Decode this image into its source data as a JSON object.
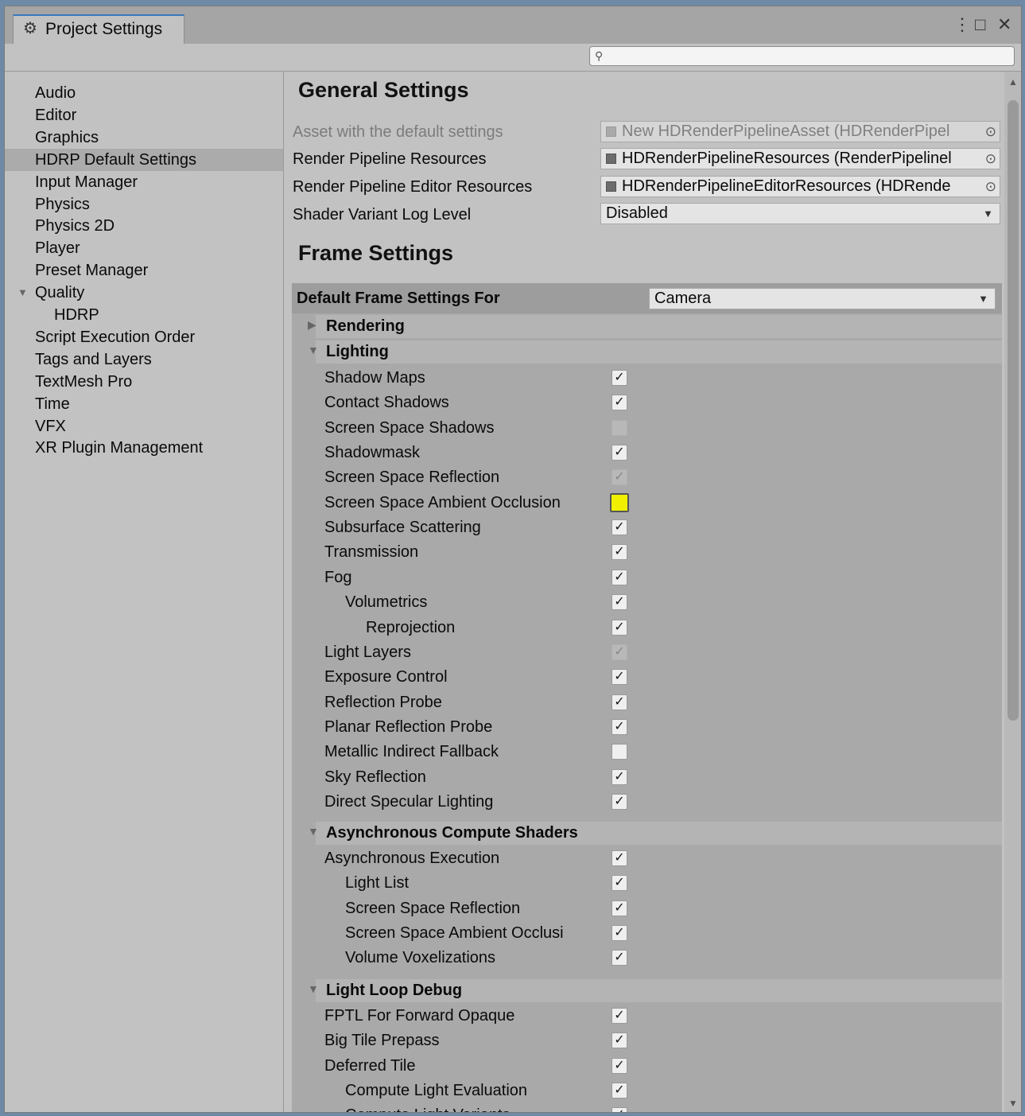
{
  "window": {
    "tab_title": "Project Settings",
    "controls": {
      "menu": "⋮",
      "maximize": "□",
      "close": "✕"
    }
  },
  "search": {
    "placeholder": "",
    "value": ""
  },
  "sidebar": {
    "items": [
      {
        "label": "Audio"
      },
      {
        "label": "Editor"
      },
      {
        "label": "Graphics"
      },
      {
        "label": "HDRP Default Settings",
        "selected": true
      },
      {
        "label": "Input Manager"
      },
      {
        "label": "Physics"
      },
      {
        "label": "Physics 2D"
      },
      {
        "label": "Player"
      },
      {
        "label": "Preset Manager"
      },
      {
        "label": "Quality",
        "expanded": true
      },
      {
        "label": "HDRP",
        "child": true
      },
      {
        "label": "Script Execution Order"
      },
      {
        "label": "Tags and Layers"
      },
      {
        "label": "TextMesh Pro"
      },
      {
        "label": "Time"
      },
      {
        "label": "VFX"
      },
      {
        "label": "XR Plugin Management"
      }
    ]
  },
  "general": {
    "heading": "General Settings",
    "asset_label": "Asset with the default settings",
    "asset_value": "New HDRenderPipelineAsset (HDRenderPipel",
    "resources_label": "Render Pipeline Resources",
    "resources_value": "HDRenderPipelineResources (RenderPipelinel",
    "editor_resources_label": "Render Pipeline Editor Resources",
    "editor_resources_value": "HDRenderPipelineEditorResources (HDRende",
    "shader_log_label": "Shader Variant Log Level",
    "shader_log_value": "Disabled"
  },
  "frame": {
    "heading": "Frame Settings",
    "default_for_label": "Default Frame Settings For",
    "default_for_value": "Camera",
    "sections": {
      "rendering": "Rendering",
      "lighting": "Lighting",
      "async": "Asynchronous Compute Shaders",
      "lightloop": "Light Loop Debug"
    },
    "lighting_rows": [
      {
        "label": "Shadow Maps",
        "state": "checked",
        "indent": 0
      },
      {
        "label": "Contact Shadows",
        "state": "checked",
        "indent": 0
      },
      {
        "label": "Screen Space Shadows",
        "state": "disabled_unchecked",
        "indent": 0
      },
      {
        "label": "Shadowmask",
        "state": "checked",
        "indent": 0
      },
      {
        "label": "Screen Space Reflection",
        "state": "disabled_checked",
        "indent": 0
      },
      {
        "label": "Screen Space Ambient Occlusion",
        "state": "highlighted",
        "indent": 0
      },
      {
        "label": "Subsurface Scattering",
        "state": "checked",
        "indent": 0
      },
      {
        "label": "Transmission",
        "state": "checked",
        "indent": 0
      },
      {
        "label": "Fog",
        "state": "checked",
        "indent": 0
      },
      {
        "label": "Volumetrics",
        "state": "checked",
        "indent": 1
      },
      {
        "label": "Reprojection",
        "state": "checked",
        "indent": 2
      },
      {
        "label": "Light Layers",
        "state": "disabled_checked",
        "indent": 0
      },
      {
        "label": "Exposure Control",
        "state": "checked",
        "indent": 0
      },
      {
        "label": "Reflection Probe",
        "state": "checked",
        "indent": 0
      },
      {
        "label": "Planar Reflection Probe",
        "state": "checked",
        "indent": 0
      },
      {
        "label": "Metallic Indirect Fallback",
        "state": "unchecked",
        "indent": 0
      },
      {
        "label": "Sky Reflection",
        "state": "checked",
        "indent": 0
      },
      {
        "label": "Direct Specular Lighting",
        "state": "checked",
        "indent": 0
      }
    ],
    "async_rows": [
      {
        "label": "Asynchronous Execution",
        "state": "checked",
        "indent": 0
      },
      {
        "label": "Light List",
        "state": "checked",
        "indent": 1
      },
      {
        "label": "Screen Space Reflection",
        "state": "checked",
        "indent": 1
      },
      {
        "label": "Screen Space Ambient Occlusi",
        "state": "checked",
        "indent": 1
      },
      {
        "label": "Volume Voxelizations",
        "state": "checked",
        "indent": 1
      }
    ],
    "lightloop_rows": [
      {
        "label": "FPTL For Forward Opaque",
        "state": "checked",
        "indent": 0
      },
      {
        "label": "Big Tile Prepass",
        "state": "checked",
        "indent": 0
      },
      {
        "label": "Deferred Tile",
        "state": "checked",
        "indent": 0
      },
      {
        "label": "Compute Light Evaluation",
        "state": "checked",
        "indent": 1
      },
      {
        "label": "Compute Light Variants",
        "state": "checked",
        "indent": 1
      }
    ]
  },
  "icons": {
    "gear": "gear-icon",
    "search": "search-icon",
    "check": "✓",
    "picker": "⊙",
    "fold_open": "▼",
    "fold_closed": "▶"
  },
  "colors": {
    "highlight_checkbox": "#f0f000",
    "tab_accent": "#3a79bb"
  }
}
